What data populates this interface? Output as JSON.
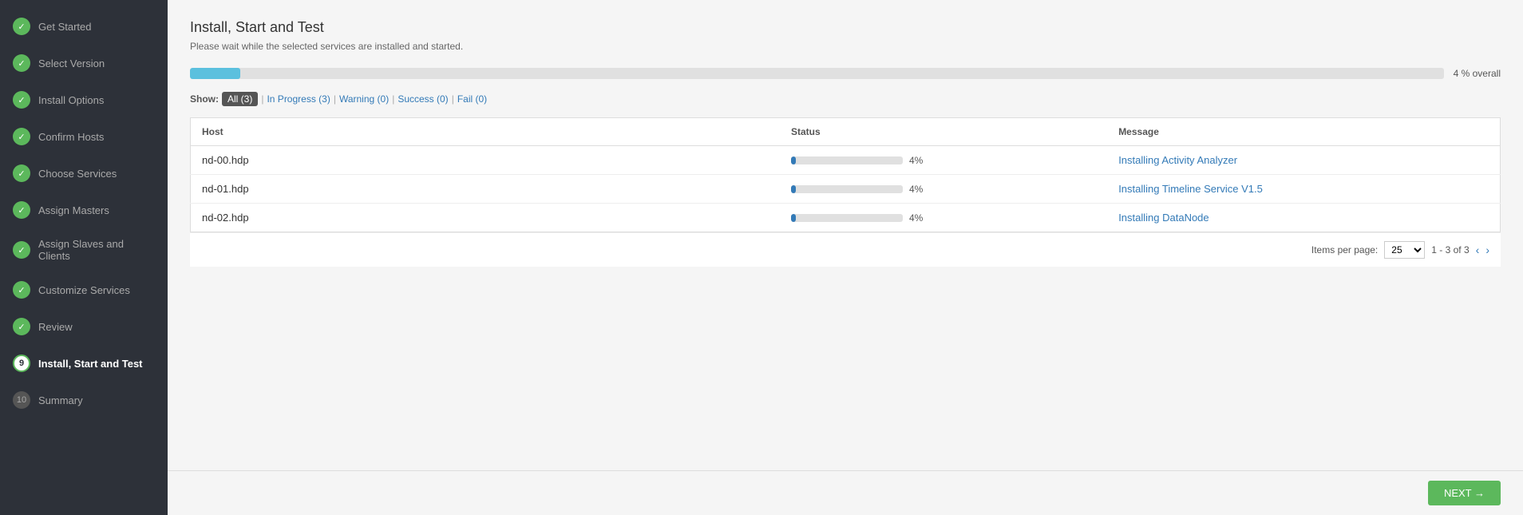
{
  "sidebar": {
    "items": [
      {
        "id": "get-started",
        "label": "Get Started",
        "step": "✓",
        "state": "completed"
      },
      {
        "id": "select-version",
        "label": "Select Version",
        "step": "✓",
        "state": "completed"
      },
      {
        "id": "install-options",
        "label": "Install Options",
        "step": "✓",
        "state": "completed"
      },
      {
        "id": "confirm-hosts",
        "label": "Confirm Hosts",
        "step": "✓",
        "state": "completed"
      },
      {
        "id": "choose-services",
        "label": "Choose Services",
        "step": "✓",
        "state": "completed"
      },
      {
        "id": "assign-masters",
        "label": "Assign Masters",
        "step": "✓",
        "state": "completed"
      },
      {
        "id": "assign-slaves",
        "label": "Assign Slaves and Clients",
        "step": "✓",
        "state": "completed"
      },
      {
        "id": "customize-services",
        "label": "Customize Services",
        "step": "✓",
        "state": "completed"
      },
      {
        "id": "review",
        "label": "Review",
        "step": "✓",
        "state": "completed"
      },
      {
        "id": "install-start",
        "label": "Install, Start and Test",
        "step": "9",
        "state": "active"
      },
      {
        "id": "summary",
        "label": "Summary",
        "step": "10",
        "state": "pending"
      }
    ]
  },
  "main": {
    "title": "Install, Start and Test",
    "subtitle": "Please wait while the selected services are installed and started.",
    "overall_progress_pct": 4,
    "overall_progress_label": "4 % overall",
    "filter": {
      "show_label": "Show:",
      "all_label": "All (3)",
      "in_progress_label": "In Progress (3)",
      "warning_label": "Warning (0)",
      "success_label": "Success (0)",
      "fail_label": "Fail (0)"
    },
    "table": {
      "columns": [
        "Host",
        "Status",
        "Message"
      ],
      "rows": [
        {
          "host": "nd-00.hdp",
          "pct": 4,
          "message": "Installing Activity Analyzer"
        },
        {
          "host": "nd-01.hdp",
          "pct": 4,
          "message": "Installing Timeline Service V1.5"
        },
        {
          "host": "nd-02.hdp",
          "pct": 4,
          "message": "Installing DataNode"
        }
      ]
    },
    "pagination": {
      "items_per_page_label": "Items per page:",
      "per_page": "25",
      "range": "1 - 3 of 3"
    }
  },
  "footer": {
    "next_label": "NEXT →"
  }
}
